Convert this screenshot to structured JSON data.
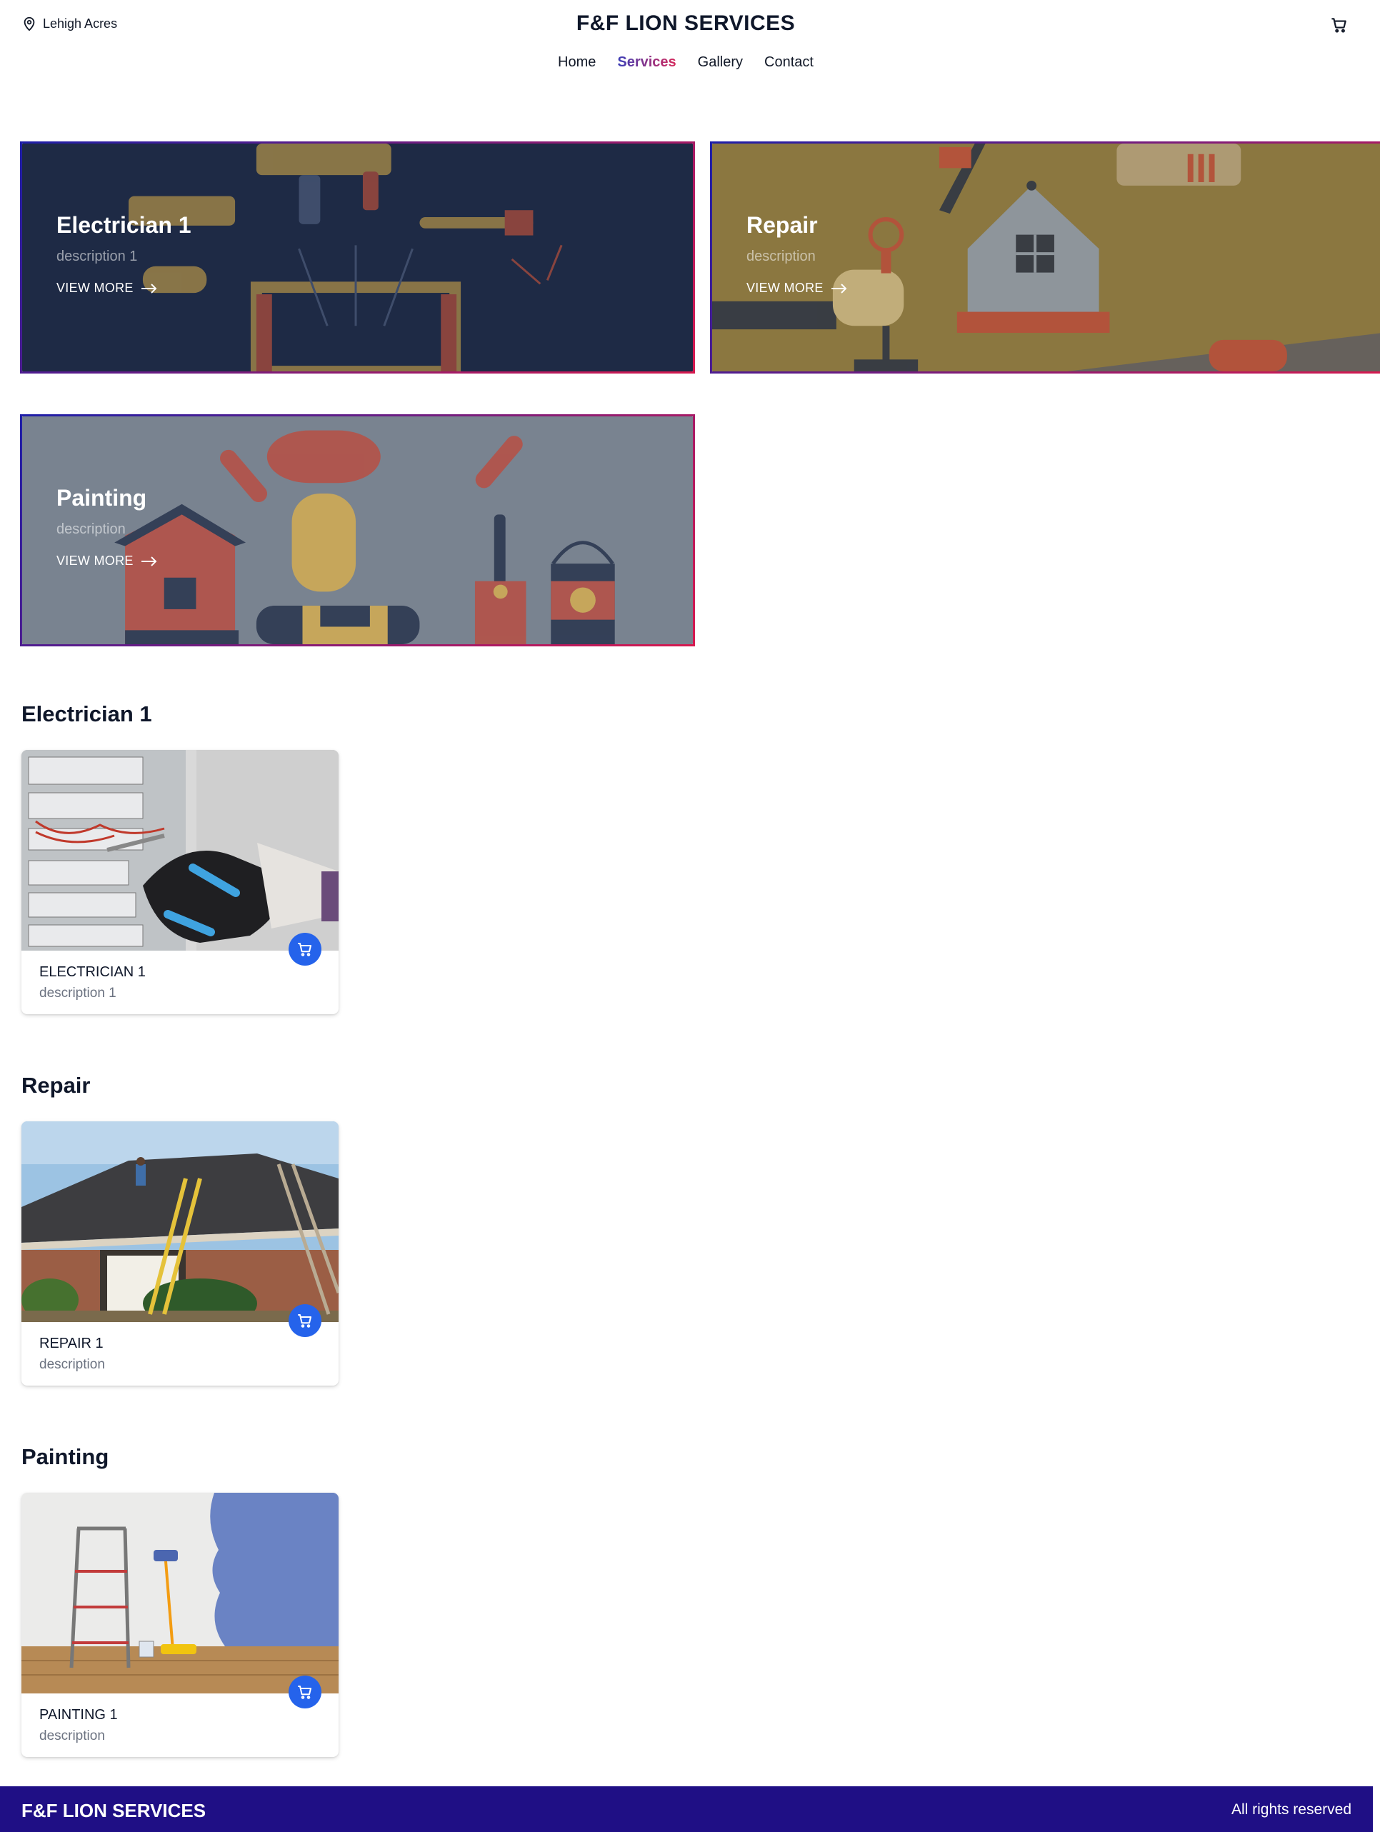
{
  "header": {
    "location": "Lehigh Acres",
    "brand": "F&F LION SERVICES",
    "nav": [
      {
        "label": "Home",
        "active": false
      },
      {
        "label": "Services",
        "active": true
      },
      {
        "label": "Gallery",
        "active": false
      },
      {
        "label": "Contact",
        "active": false
      }
    ],
    "icons": {
      "location": "map-pin-icon",
      "cart": "cart-icon"
    }
  },
  "banners": [
    {
      "title": "Electrician 1",
      "description": "description 1",
      "cta": "VIEW MORE",
      "bg": "#1e2a45"
    },
    {
      "title": "Repair",
      "description": "description",
      "cta": "VIEW MORE",
      "bg": "#8b7740"
    },
    {
      "title": "Painting",
      "description": "description",
      "cta": "VIEW MORE",
      "bg": "#798390"
    }
  ],
  "sections": [
    {
      "title": "Electrician 1",
      "card": {
        "name": "ELECTRICIAN 1",
        "description": "description 1"
      }
    },
    {
      "title": "Repair",
      "card": {
        "name": "REPAIR 1",
        "description": "description"
      }
    },
    {
      "title": "Painting",
      "card": {
        "name": "PAINTING 1",
        "description": "description"
      }
    }
  ],
  "footer": {
    "brand": "F&F LION SERVICES",
    "copyright": "All rights reserved",
    "bg": "#1f0f85"
  },
  "colors": {
    "accent": "#2563eb",
    "gradient_start": "#3b3fb8",
    "gradient_end": "#d6275a"
  }
}
